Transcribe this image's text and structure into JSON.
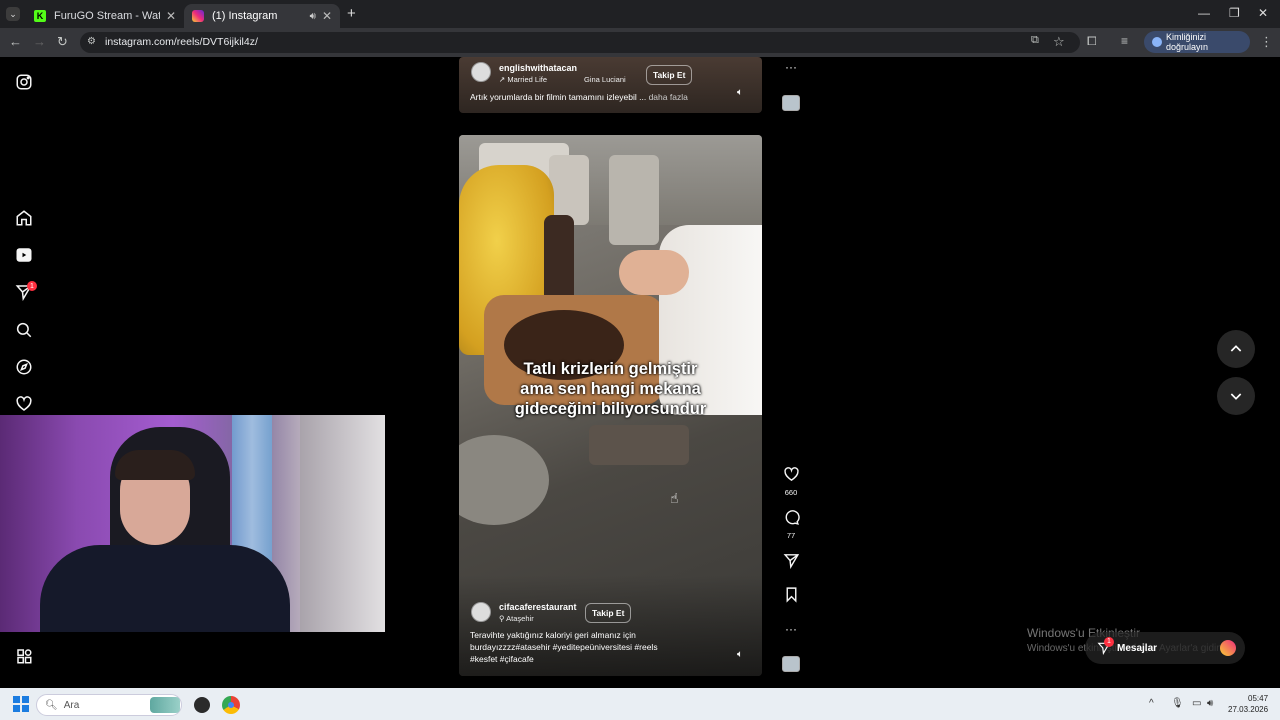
{
  "browser": {
    "tabs": [
      {
        "title": "FuruGO Stream - Watch Live on",
        "favicon": "kick-icon",
        "active": false
      },
      {
        "title": "(1) Instagram",
        "favicon": "instagram-icon",
        "active": true
      }
    ],
    "url": "instagram.com/reels/DVT6ijkil4z/",
    "verify_label": "Kimliğinizi doğrulayın"
  },
  "sidebar": {
    "items": [
      "instagram-logo-icon",
      "home-icon",
      "reels-icon",
      "messages-icon",
      "search-icon",
      "explore-icon",
      "notifications-icon",
      "more-icon"
    ],
    "badge": "1"
  },
  "reels": [
    {
      "username": "englishwithatacan",
      "audio": "Married Life",
      "audio_artist": "Gina Luciani",
      "follow_label": "Takip Et",
      "caption": "Artık yorumlarda bir filmin tamamını izleyebil ...",
      "more_label": "daha fazla"
    },
    {
      "overlay_text": [
        "Tatlı krizlerin gelmiştir",
        "ama sen hangi mekana",
        "gideceğini biliyorsundur"
      ],
      "username": "cifacaferestaurant",
      "location": "Ataşehir",
      "follow_label": "Takip Et",
      "caption": [
        "Teravihte yaktığınız kaloriyi geri almanız için",
        "burdayızzzz#atasehir #yeditepeüniversitesi #reels",
        "#kesfet #çifacafe"
      ],
      "likes": "660",
      "comments": "77"
    }
  ],
  "windows_watermark": {
    "title": "Windows'u Etkinleştir",
    "subtitle": "Windows'u etkinleştirmek için Ayarlar'a gidin."
  },
  "messages": {
    "label": "Mesajlar",
    "badge": "1"
  },
  "taskbar": {
    "search_placeholder": "Ara",
    "time": "05:47",
    "date": "27.03.2026"
  }
}
